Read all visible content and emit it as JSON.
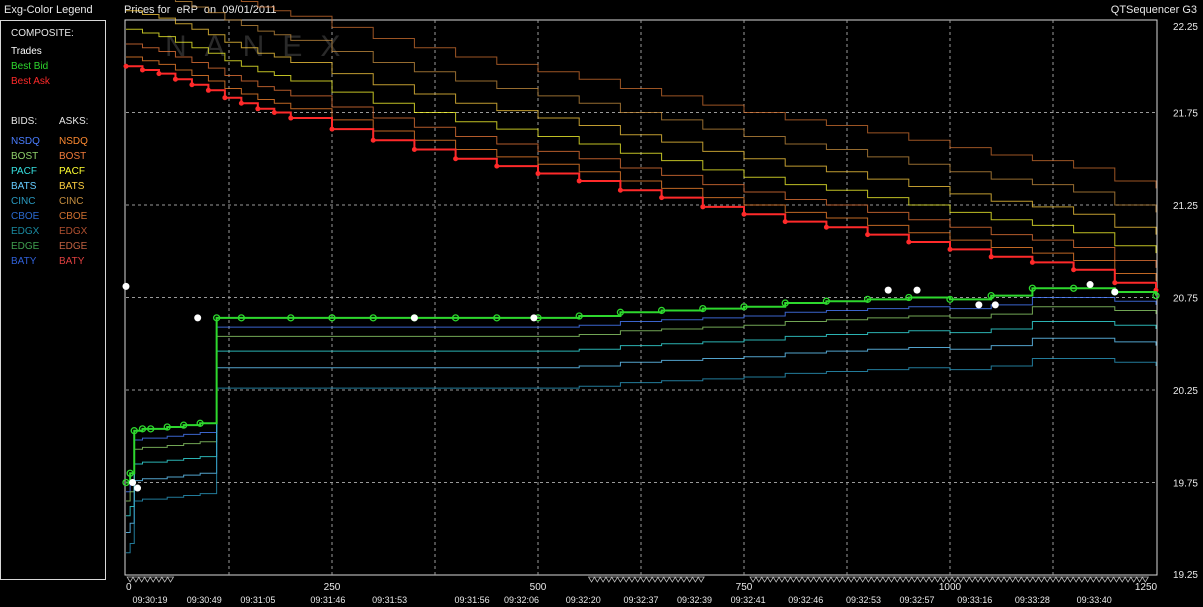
{
  "window": {
    "left_title": "Exg-Color Legend",
    "center_title": "Prices for  eRP  on  09/01/2011",
    "right_title": "QTSequencer G3"
  },
  "legend": {
    "composite_header": "COMPOSITE:",
    "composite": [
      {
        "label": "Trades",
        "color": "#ffffff"
      },
      {
        "label": "Best Bid",
        "color": "#2ed82e"
      },
      {
        "label": "Best Ask",
        "color": "#ff2a2a"
      }
    ],
    "bids_header": "BIDS:",
    "asks_header": "ASKS:",
    "exchanges": [
      {
        "bid": "NSDQ",
        "ask": "NSDQ",
        "bid_color": "#4a7dff",
        "ask_color": "#ff8a30"
      },
      {
        "bid": "BOST",
        "ask": "BOST",
        "bid_color": "#8fd06a",
        "ask_color": "#f07a3a"
      },
      {
        "bid": "PACF",
        "ask": "PACF",
        "bid_color": "#36e0e0",
        "ask_color": "#ffff30"
      },
      {
        "bid": "BATS",
        "ask": "BATS",
        "bid_color": "#66ccff",
        "ask_color": "#ffd040"
      },
      {
        "bid": "CINC",
        "ask": "CINC",
        "bid_color": "#2a9ac0",
        "ask_color": "#c89040"
      },
      {
        "bid": "CBOE",
        "ask": "CBOE",
        "bid_color": "#2a6ad0",
        "ask_color": "#d07030"
      },
      {
        "bid": "EDGX",
        "ask": "EDGX",
        "bid_color": "#1a8aa0",
        "ask_color": "#b05030"
      },
      {
        "bid": "EDGE",
        "ask": "EDGE",
        "bid_color": "#40a050",
        "ask_color": "#c06040"
      },
      {
        "bid": "BATY",
        "ask": "BATY",
        "bid_color": "#3060d8",
        "ask_color": "#e04040"
      }
    ]
  },
  "chart_data": {
    "type": "line",
    "title": "Prices for  eRP  on  09/01/2011",
    "watermark": "NANEX",
    "ylim": [
      19.25,
      22.25
    ],
    "yticks": [
      "22.25",
      "21.75",
      "21.25",
      "20.75",
      "20.25",
      "19.75",
      "19.25"
    ],
    "xlim": [
      0,
      1250
    ],
    "xticks": [
      "0",
      "250",
      "500",
      "750",
      "1000",
      "1250"
    ],
    "time_labels": [
      {
        "x": 10,
        "label": "09:30:19"
      },
      {
        "x": 95,
        "label": "09:30:49"
      },
      {
        "x": 160,
        "label": "09:31:05"
      },
      {
        "x": 245,
        "label": "09:31:46"
      },
      {
        "x": 320,
        "label": "09:31:53"
      },
      {
        "x": 420,
        "label": "09:31:56"
      },
      {
        "x": 480,
        "label": "09:32:06"
      },
      {
        "x": 555,
        "label": "09:32:20"
      },
      {
        "x": 625,
        "label": "09:32:37"
      },
      {
        "x": 690,
        "label": "09:32:39"
      },
      {
        "x": 755,
        "label": "09:32:41"
      },
      {
        "x": 825,
        "label": "09:32:46"
      },
      {
        "x": 895,
        "label": "09:32:53"
      },
      {
        "x": 960,
        "label": "09:32:57"
      },
      {
        "x": 1030,
        "label": "09:33:16"
      },
      {
        "x": 1100,
        "label": "09:33:28"
      },
      {
        "x": 1175,
        "label": "09:33:40"
      }
    ],
    "grid": true,
    "series": [
      {
        "name": "Best Ask",
        "color": "#ff2a2a",
        "x": [
          0,
          20,
          40,
          60,
          80,
          100,
          120,
          140,
          160,
          180,
          200,
          250,
          300,
          350,
          400,
          450,
          500,
          550,
          600,
          650,
          700,
          750,
          800,
          850,
          900,
          950,
          1000,
          1050,
          1100,
          1150,
          1200,
          1250
        ],
        "y": [
          22.0,
          21.98,
          21.96,
          21.93,
          21.9,
          21.87,
          21.83,
          21.8,
          21.77,
          21.75,
          21.72,
          21.66,
          21.6,
          21.55,
          21.5,
          21.46,
          21.42,
          21.38,
          21.33,
          21.29,
          21.24,
          21.2,
          21.16,
          21.13,
          21.09,
          21.05,
          21.01,
          20.97,
          20.94,
          20.9,
          20.83,
          20.79
        ]
      },
      {
        "name": "Best Bid",
        "color": "#2ed82e",
        "x": [
          0,
          5,
          10,
          20,
          30,
          50,
          70,
          90,
          110,
          140,
          200,
          250,
          300,
          350,
          400,
          450,
          500,
          550,
          600,
          650,
          700,
          750,
          800,
          850,
          900,
          950,
          1000,
          1050,
          1100,
          1150,
          1200,
          1250
        ],
        "y": [
          19.75,
          19.8,
          20.03,
          20.04,
          20.04,
          20.05,
          20.06,
          20.07,
          20.64,
          20.64,
          20.64,
          20.64,
          20.64,
          20.64,
          20.64,
          20.64,
          20.64,
          20.65,
          20.67,
          20.68,
          20.69,
          20.7,
          20.72,
          20.73,
          20.74,
          20.75,
          20.74,
          20.76,
          20.8,
          20.8,
          20.78,
          20.76
        ]
      },
      {
        "name": "Trades",
        "color": "#ffffff",
        "x": [
          0,
          8,
          14,
          87,
          350,
          495,
          925,
          960,
          1035,
          1055,
          1170,
          1200
        ],
        "y": [
          20.81,
          19.75,
          19.72,
          20.64,
          20.64,
          20.64,
          20.79,
          20.79,
          20.71,
          20.71,
          20.82,
          20.78
        ]
      }
    ]
  }
}
